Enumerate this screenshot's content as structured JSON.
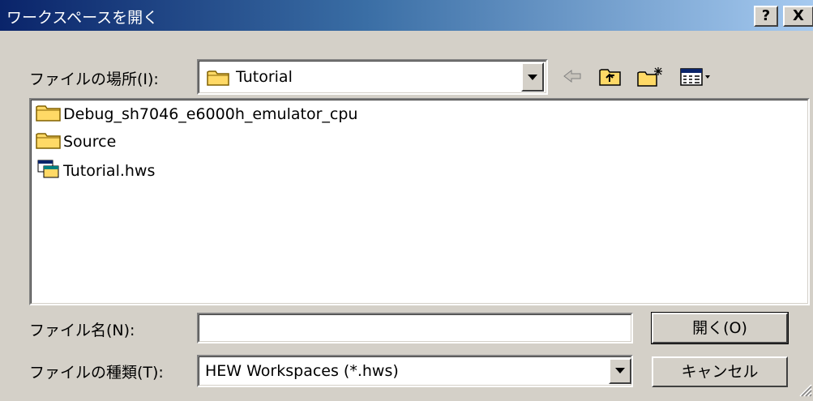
{
  "dialog": {
    "title": "ワークスペースを開く",
    "help_label": "?",
    "close_label": "X"
  },
  "lookin": {
    "label": "ファイルの場所(I):",
    "value": "Tutorial"
  },
  "files": [
    {
      "name": "Debug_sh7046_e6000h_emulator_cpu",
      "icon": "folder-icon"
    },
    {
      "name": "Source",
      "icon": "folder-icon"
    },
    {
      "name": "Tutorial.hws",
      "icon": "workspace-file-icon"
    }
  ],
  "filename": {
    "label": "ファイル名(N):",
    "value": ""
  },
  "filetype": {
    "label": "ファイルの種類(T):",
    "value": "HEW Workspaces (*.hws)"
  },
  "buttons": {
    "open": "開く(O)",
    "cancel": "キャンセル"
  },
  "toolbar": {
    "back": "back-arrow-icon",
    "up": "up-folder-icon",
    "new_folder": "new-folder-icon",
    "view_menu": "view-menu-icon"
  }
}
